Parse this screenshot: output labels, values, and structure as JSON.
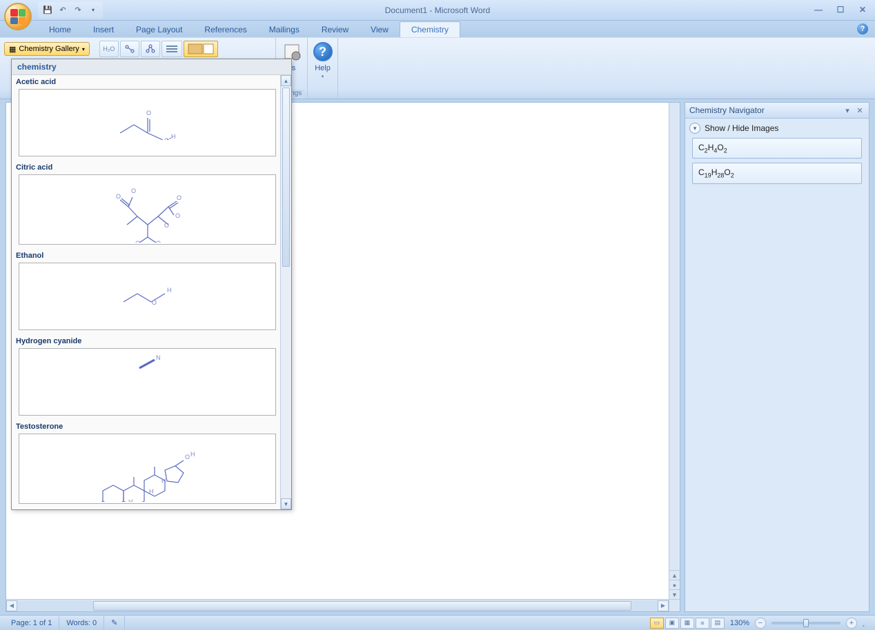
{
  "title": "Document1 - Microsoft Word",
  "qat": {
    "save": "save-icon",
    "undo": "undo-icon",
    "redo": "redo-icon"
  },
  "tabs": [
    "Home",
    "Insert",
    "Page Layout",
    "References",
    "Mailings",
    "Review",
    "View",
    "Chemistry"
  ],
  "active_tab": "Chemistry",
  "ribbon": {
    "gallery_btn": "Chemistry Gallery",
    "help_label": "Help",
    "partial_labels": {
      "options_suffix": "ns",
      "settings_suffix": "ettings"
    },
    "group_settings": "Settings"
  },
  "gallery": {
    "header": "chemistry",
    "items": [
      {
        "title": "Acetic acid"
      },
      {
        "title": "Citric acid"
      },
      {
        "title": "Ethanol"
      },
      {
        "title": "Hydrogen cyanide"
      },
      {
        "title": "Testosterone"
      }
    ]
  },
  "navigator": {
    "title": "Chemistry Navigator",
    "toggle_label": "Show / Hide Images",
    "formulas": [
      {
        "display": "C2H4O2",
        "parts": [
          [
            "C",
            "2"
          ],
          [
            "H",
            "4"
          ],
          [
            "O",
            "2"
          ]
        ]
      },
      {
        "display": "C19H28O2",
        "parts": [
          [
            "C",
            "19"
          ],
          [
            "H",
            "28"
          ],
          [
            "O",
            "2"
          ]
        ]
      }
    ]
  },
  "statusbar": {
    "page": "Page: 1 of 1",
    "words": "Words: 0",
    "zoom": "130%"
  },
  "colors": {
    "accent": "#2a5a9e",
    "ribbon_bg": "#eaf2fc",
    "gallery_sel": "#ffd96a"
  }
}
